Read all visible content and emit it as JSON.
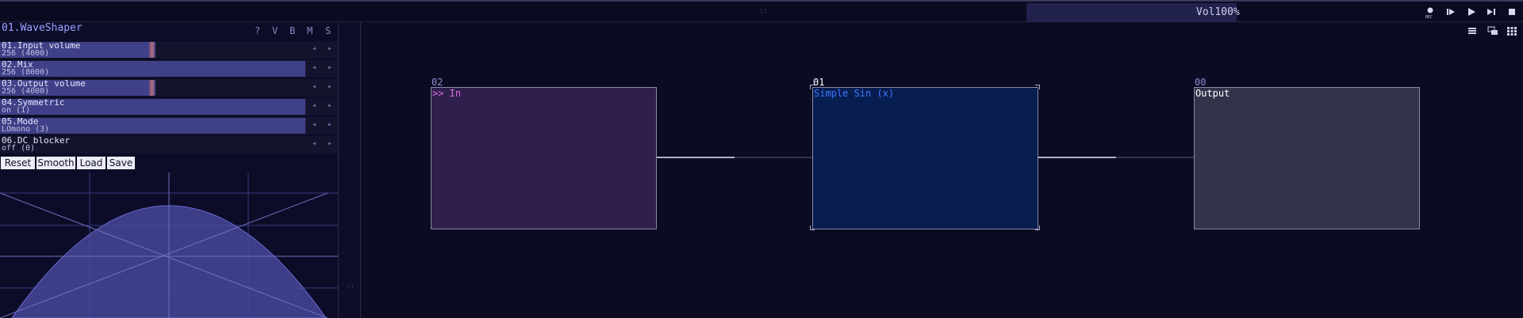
{
  "header": {
    "center_dots": "::",
    "volume_label": "Vol100%",
    "rec_label": "REC",
    "transport_icons": [
      "record-icon",
      "play-from-start-icon",
      "play-icon",
      "step-forward-icon",
      "stop-icon"
    ]
  },
  "module_panel": {
    "title": "01.WaveShaper",
    "title_buttons": [
      "?",
      "V",
      "B",
      "M",
      "S"
    ],
    "params": [
      {
        "name": "01.Input volume",
        "value": "256 (4000)",
        "fill_fraction": 0.5
      },
      {
        "name": "02.Mix",
        "value": "256 (8000)",
        "fill_fraction": 1.0
      },
      {
        "name": "03.Output volume",
        "value": "256 (4000)",
        "fill_fraction": 0.5
      },
      {
        "name": "04.Symmetric",
        "value": "on (1)",
        "fill_fraction": 1.0
      },
      {
        "name": "05.Mode",
        "value": "LOmono (3)",
        "fill_fraction": 1.0
      },
      {
        "name": "06.DC blocker",
        "value": "off (0)",
        "fill_fraction": 0.0
      }
    ],
    "actions": [
      "Reset",
      "Smooth",
      "Load",
      "Save"
    ],
    "arrow_left": "◂",
    "arrow_right": "▸"
  },
  "graph": {
    "modules": [
      {
        "number": "02",
        "label": ">> In",
        "color": "#2f1f4c",
        "label_color": "#e070e0"
      },
      {
        "number": "01",
        "label": "Simple Sin (x)",
        "color": "#081d50",
        "label_color": "#3a7aff"
      },
      {
        "number": "00",
        "label": "Output",
        "color": "#33334a",
        "label_color": "#ffffff"
      }
    ],
    "toolbar_icons": [
      "list-icon",
      "window-icon",
      "grid-icon"
    ]
  },
  "colors": {
    "background": "#0b0b24",
    "accent": "#9aa0ff",
    "param_fill": "#404088"
  }
}
